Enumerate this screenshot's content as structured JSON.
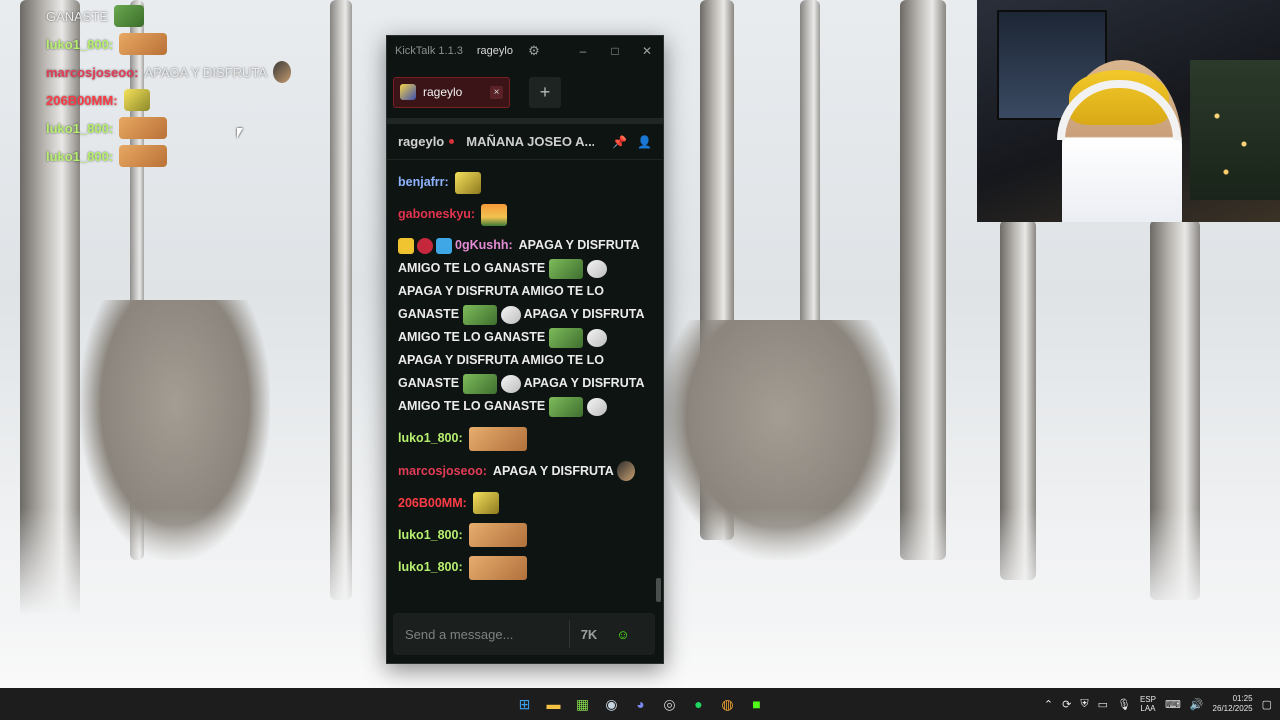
{
  "overlay_chat": [
    {
      "user": "",
      "text": "GANASTE",
      "user_color": "#eaeaea",
      "emotes": [
        "pepe"
      ]
    },
    {
      "user": "luko1_800:",
      "text": "",
      "user_color": "#b6f06e",
      "emotes": [
        "face"
      ]
    },
    {
      "user": "marcosjoseoo:",
      "text": "APAGA Y DISFRUTA",
      "user_color": "#e23b56",
      "emotes": [
        "hat"
      ]
    },
    {
      "user": "206B00MM:",
      "text": "",
      "user_color": "#ff3c46",
      "emotes": [
        "bob"
      ]
    },
    {
      "user": "luko1_800:",
      "text": "",
      "user_color": "#b6f06e",
      "emotes": [
        "face"
      ]
    },
    {
      "user": "luko1_800:",
      "text": "",
      "user_color": "#b6f06e",
      "emotes": [
        "face"
      ]
    }
  ],
  "kicktalk": {
    "app_title": "KickTalk 1.1.3",
    "account": "rageylo",
    "window_controls": [
      "minimize-icon",
      "maximize-icon",
      "close-icon"
    ],
    "tab": {
      "label": "rageylo",
      "close": "×"
    },
    "add_tab": "+",
    "stream": {
      "streamer": "rageylo",
      "title": "MAÑANA JOSEO A...",
      "live_color": "#d3323a"
    },
    "messages": [
      {
        "user": "benjafrr:",
        "color": "#8fb3ff",
        "text": "",
        "emotes": [
          "bob"
        ]
      },
      {
        "user": "gaboneskyu:",
        "color": "#e2344e",
        "text": "",
        "emotes": [
          "sun"
        ]
      },
      {
        "user": "0gKushh:",
        "color": "#e38bd3",
        "badges": [
          "b1",
          "b2",
          "b3"
        ],
        "segments": [
          "APAGA Y DISFRUTA AMIGO TE LO GANASTE",
          "APAGA Y DISFRUTA AMIGO TE LO GANASTE",
          "APAGA Y DISFRUTA AMIGO TE LO GANASTE",
          "APAGA Y DISFRUTA AMIGO TE LO GANASTE",
          "APAGA Y DISFRUTA AMIGO TE LO GANASTE"
        ]
      },
      {
        "user": "luko1_800:",
        "color": "#b6f06e",
        "text": "",
        "emotes": [
          "face"
        ]
      },
      {
        "user": "marcosjoseoo:",
        "color": "#e23b56",
        "text": "APAGA Y DISFRUTA",
        "emotes": [
          "hat"
        ]
      },
      {
        "user": "206B00MM:",
        "color": "#ff3c46",
        "text": "",
        "emotes": [
          "bob"
        ]
      },
      {
        "user": "luko1_800:",
        "color": "#b6f06e",
        "text": "",
        "emotes": [
          "face"
        ]
      },
      {
        "user": "luko1_800:",
        "color": "#b6f06e",
        "text": "",
        "emotes": [
          "face"
        ]
      }
    ],
    "input": {
      "placeholder": "Send a message...",
      "kick_emote_button": "7K",
      "emote_picker_icon": "emoji-icon"
    }
  },
  "taskbar": {
    "apps": [
      "windows-start-icon",
      "file-explorer-icon",
      "spreadsheet-app-icon",
      "steam-icon",
      "discord-icon",
      "obs-icon",
      "spotify-icon",
      "chrome-icon",
      "kick-icon"
    ],
    "lang_top": "ESP",
    "lang_bottom": "LAA",
    "time": "01:25",
    "date": "26/12/2025"
  },
  "colors": {
    "kick_green": "#53fc18",
    "tab_red": "#7a2025",
    "window_bg": "#0e1412"
  }
}
